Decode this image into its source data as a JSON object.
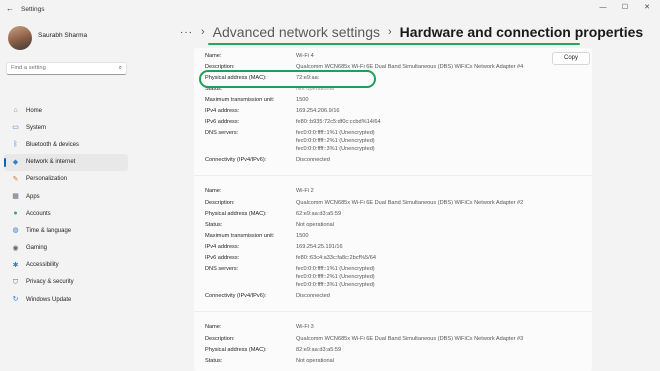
{
  "window": {
    "title": "Settings",
    "back": "←",
    "minimize": "—",
    "maximize": "☐",
    "close": "✕"
  },
  "user": {
    "name": "Saurabh Sharma"
  },
  "search": {
    "placeholder": "Find a setting"
  },
  "nav": [
    {
      "label": "Home",
      "icon": "home-icon",
      "glyph": "⌂",
      "color": "#4a90d9"
    },
    {
      "label": "System",
      "icon": "system-icon",
      "glyph": "▭",
      "color": "#2f7fcf"
    },
    {
      "label": "Bluetooth & devices",
      "icon": "bluetooth-icon",
      "glyph": "ᛒ",
      "color": "#2f7fcf"
    },
    {
      "label": "Network & internet",
      "icon": "network-icon",
      "glyph": "◆",
      "color": "#2f7fcf",
      "active": true
    },
    {
      "label": "Personalization",
      "icon": "brush-icon",
      "glyph": "✎",
      "color": "#d9762f"
    },
    {
      "label": "Apps",
      "icon": "apps-icon",
      "glyph": "▦",
      "color": "#5a6b7e"
    },
    {
      "label": "Accounts",
      "icon": "accounts-icon",
      "glyph": "●",
      "color": "#2faa6e"
    },
    {
      "label": "Time & language",
      "icon": "globe-icon",
      "glyph": "◍",
      "color": "#2f7fcf"
    },
    {
      "label": "Gaming",
      "icon": "gaming-icon",
      "glyph": "◉",
      "color": "#666666"
    },
    {
      "label": "Accessibility",
      "icon": "accessibility-icon",
      "glyph": "✱",
      "color": "#2f7fcf"
    },
    {
      "label": "Privacy & security",
      "icon": "shield-icon",
      "glyph": "⛉",
      "color": "#6a6a6a"
    },
    {
      "label": "Windows Update",
      "icon": "update-icon",
      "glyph": "↻",
      "color": "#2f7fcf"
    }
  ],
  "header": {
    "more": "···",
    "chevron": "›",
    "crumb1": "Advanced network settings",
    "crumb2": "Hardware and connection properties"
  },
  "copy_button": "Copy",
  "labels": {
    "name": "Name:",
    "description": "Description:",
    "mac": "Physical address (MAC):",
    "status": "Status:",
    "mtu": "Maximum transmission unit:",
    "ipv4": "IPv4 address:",
    "ipv6": "IPv6 address:",
    "dns": "DNS servers:",
    "conn": "Connectivity (IPv4/IPv6):"
  },
  "adapters": [
    {
      "name": "Wi-Fi 4",
      "description": "Qualcomm WCN685x Wi-Fi 6E Dual Band Simultaneous (DBS) WiFiCx Network Adapter #4",
      "mac": "72:e9:aa:",
      "status": "Not operational",
      "mtu": "1500",
      "ipv4": "169.254.206.9/16",
      "ipv6": "fe80::b935:72c5:df0c:ccbd%14/64",
      "dns": [
        "fec0:0:0:ffff::1%1 (Unencrypted)",
        "fec0:0:0:ffff::2%1 (Unencrypted)",
        "fec0:0:0:ffff::3%1 (Unencrypted)"
      ],
      "conn": "Disconnected"
    },
    {
      "name": "Wi-Fi 2",
      "description": "Qualcomm WCN685x Wi-Fi 6E Dual Band Simultaneous (DBS) WiFiCx Network Adapter #2",
      "mac": "62:e9:aa:d3:a5:59",
      "status": "Not operational",
      "mtu": "1500",
      "ipv4": "169.254.25.191/16",
      "ipv6": "fe80::63c4:a33c:fa8c:2bcf%5/64",
      "dns": [
        "fec0:0:0:ffff::1%1 (Unencrypted)",
        "fec0:0:0:ffff::2%1 (Unencrypted)",
        "fec0:0:0:ffff::3%1 (Unencrypted)"
      ],
      "conn": "Disconnected"
    },
    {
      "name": "Wi-Fi 3",
      "description": "Qualcomm WCN685x Wi-Fi 6E Dual Band Simultaneous (DBS) WiFiCx Network Adapter #3",
      "mac": "82:e9:aa:d3:a5:59",
      "status": "Not operational"
    }
  ]
}
